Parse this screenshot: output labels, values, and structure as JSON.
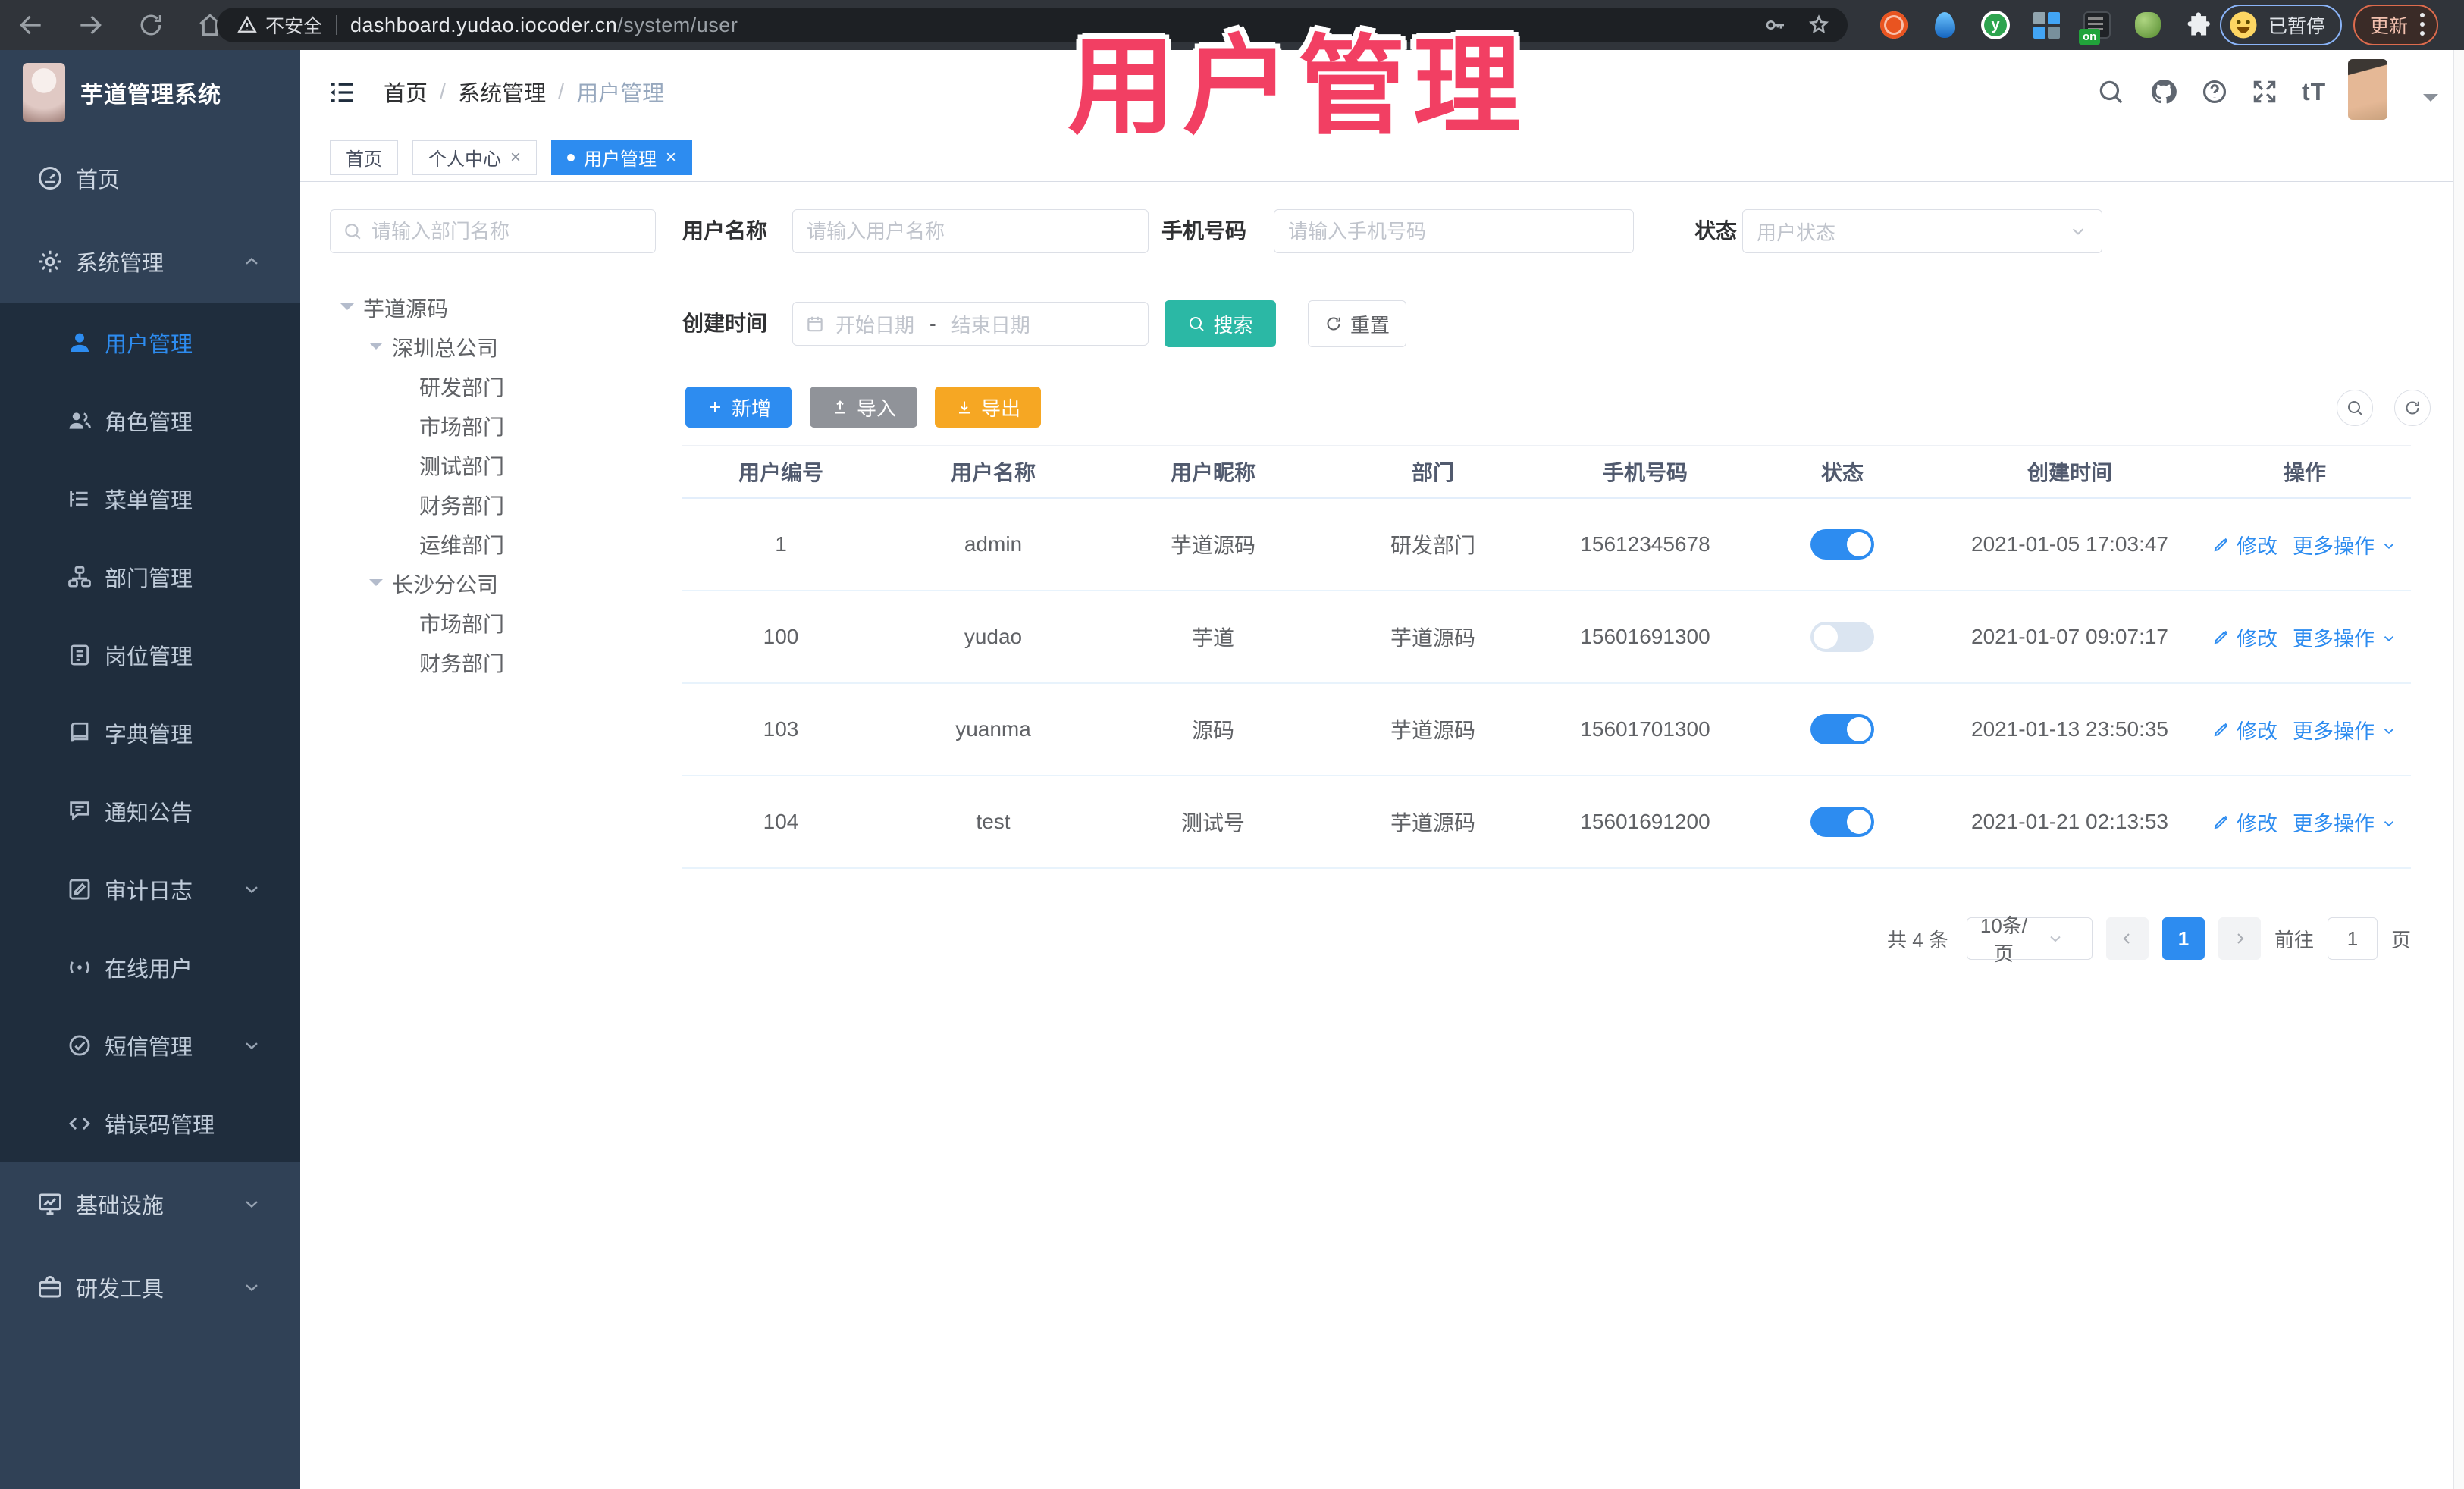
{
  "browser": {
    "security_label": "不安全",
    "url_host": "dashboard.yudao.iocoder.cn",
    "url_path": "/system/user",
    "ext_on_badge": "on",
    "ext_y_letter": "y",
    "profile_badge": "已暂停",
    "update_label": "更新"
  },
  "overlay": {
    "title": "用户管理",
    "color": "#f23f63"
  },
  "sidebar": {
    "logo_title": "芋道管理系统",
    "menu": [
      {
        "label": "首页",
        "icon": "dashboard-icon",
        "level": 1
      },
      {
        "label": "系统管理",
        "icon": "gear-icon",
        "level": 1,
        "arrow": "up"
      },
      {
        "label": "用户管理",
        "icon": "user-icon",
        "level": 2,
        "active": true
      },
      {
        "label": "角色管理",
        "icon": "users-icon",
        "level": 2
      },
      {
        "label": "菜单管理",
        "icon": "menu-tree-icon",
        "level": 2
      },
      {
        "label": "部门管理",
        "icon": "org-icon",
        "level": 2
      },
      {
        "label": "岗位管理",
        "icon": "post-icon",
        "level": 2
      },
      {
        "label": "字典管理",
        "icon": "dict-icon",
        "level": 2
      },
      {
        "label": "通知公告",
        "icon": "notice-icon",
        "level": 2
      },
      {
        "label": "审计日志",
        "icon": "audit-icon",
        "level": 2,
        "arrow": "down"
      },
      {
        "label": "在线用户",
        "icon": "online-icon",
        "level": 2
      },
      {
        "label": "短信管理",
        "icon": "sms-icon",
        "level": 2,
        "arrow": "down"
      },
      {
        "label": "错误码管理",
        "icon": "code-icon",
        "level": 2
      },
      {
        "label": "基础设施",
        "icon": "infra-icon",
        "level": 1,
        "arrow": "down"
      },
      {
        "label": "研发工具",
        "icon": "tools-icon",
        "level": 1,
        "arrow": "down"
      }
    ]
  },
  "header": {
    "breadcrumb": [
      "首页",
      "系统管理",
      "用户管理"
    ]
  },
  "tabs": [
    {
      "label": "首页",
      "closable": false,
      "active": false
    },
    {
      "label": "个人中心",
      "closable": true,
      "active": false
    },
    {
      "label": "用户管理",
      "closable": true,
      "active": true
    }
  ],
  "dept_panel": {
    "search_placeholder": "请输入部门名称",
    "tree": [
      {
        "label": "芋道源码",
        "level": 1,
        "caret": true
      },
      {
        "label": "深圳总公司",
        "level": 2,
        "caret": true
      },
      {
        "label": "研发部门",
        "level": 3
      },
      {
        "label": "市场部门",
        "level": 3
      },
      {
        "label": "测试部门",
        "level": 3
      },
      {
        "label": "财务部门",
        "level": 3
      },
      {
        "label": "运维部门",
        "level": 3
      },
      {
        "label": "长沙分公司",
        "level": 2,
        "caret": true
      },
      {
        "label": "市场部门",
        "level": 3
      },
      {
        "label": "财务部门",
        "level": 3
      }
    ]
  },
  "filters": {
    "user_name_label": "用户名称",
    "user_name_placeholder": "请输入用户名称",
    "mobile_label": "手机号码",
    "mobile_placeholder": "请输入手机号码",
    "status_label": "状态",
    "status_placeholder": "用户状态",
    "create_time_label": "创建时间",
    "date_start_placeholder": "开始日期",
    "date_separator": "-",
    "date_end_placeholder": "结束日期",
    "search_label": "搜索",
    "reset_label": "重置"
  },
  "toolbar": {
    "add_label": "新增",
    "import_label": "导入",
    "export_label": "导出"
  },
  "table": {
    "columns": [
      "用户编号",
      "用户名称",
      "用户昵称",
      "部门",
      "手机号码",
      "状态",
      "创建时间",
      "操作"
    ],
    "rows": [
      {
        "id": "1",
        "username": "admin",
        "nickname": "芋道源码",
        "dept": "研发部门",
        "mobile": "15612345678",
        "status": true,
        "created": "2021-01-05 17:03:47"
      },
      {
        "id": "100",
        "username": "yudao",
        "nickname": "芋道",
        "dept": "芋道源码",
        "mobile": "15601691300",
        "status": false,
        "created": "2021-01-07 09:07:17"
      },
      {
        "id": "103",
        "username": "yuanma",
        "nickname": "源码",
        "dept": "芋道源码",
        "mobile": "15601701300",
        "status": true,
        "created": "2021-01-13 23:50:35"
      },
      {
        "id": "104",
        "username": "test",
        "nickname": "测试号",
        "dept": "芋道源码",
        "mobile": "15601691200",
        "status": true,
        "created": "2021-01-21 02:13:53"
      }
    ],
    "actions": {
      "edit": "修改",
      "more": "更多操作"
    }
  },
  "pagination": {
    "total_text": "共 4 条",
    "page_size": "10条/页",
    "current_page": "1",
    "goto_label": "前往",
    "goto_value": "1",
    "page_unit": "页"
  },
  "colors": {
    "accent": "#2d8cf0",
    "teal": "#2bb8a5",
    "orange": "#f6a723",
    "pink": "#f23f63"
  }
}
